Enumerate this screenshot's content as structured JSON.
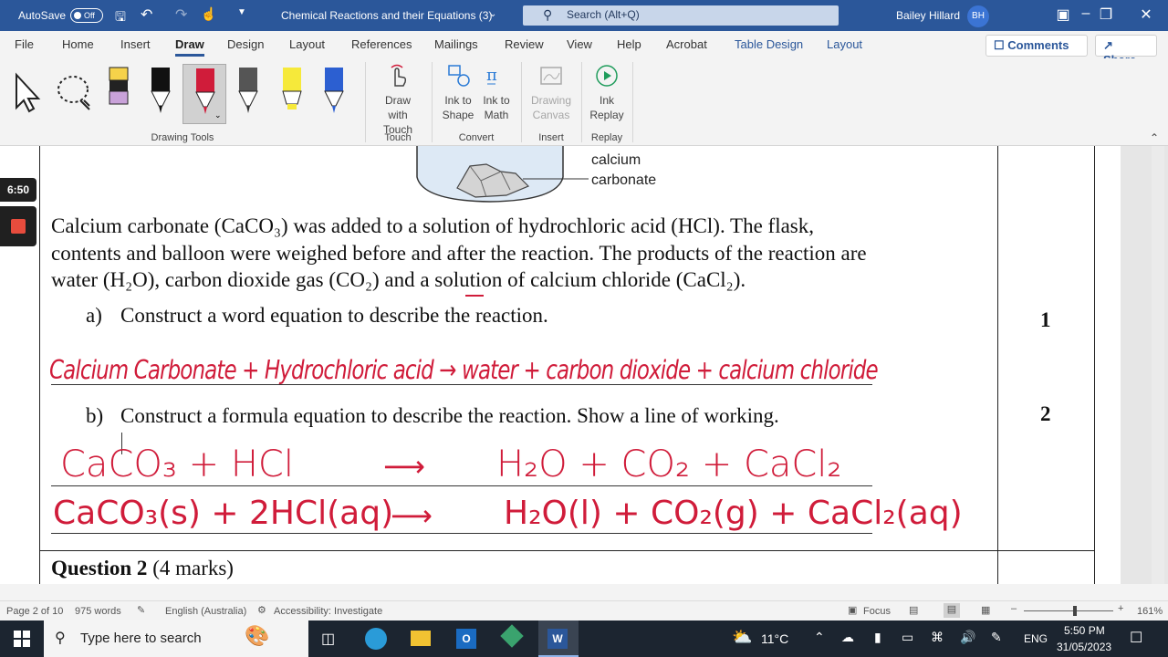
{
  "titlebar": {
    "autosave_label": "AutoSave",
    "autosave_state": "Off",
    "doc_title": "Chemical Reactions and their Equations (3)",
    "search_placeholder": "Search (Alt+Q)",
    "user_name": "Bailey Hillard",
    "user_initials": "BH"
  },
  "menu": {
    "tabs": [
      "File",
      "Home",
      "Insert",
      "Draw",
      "Design",
      "Layout",
      "References",
      "Mailings",
      "Review",
      "View",
      "Help",
      "Acrobat",
      "Table Design",
      "Layout"
    ],
    "active_tab": "Draw",
    "comments_label": "Comments",
    "share_label": "Share"
  },
  "ribbon": {
    "drawing_tools_label": "Drawing Tools",
    "draw_with_touch": "Draw with Touch",
    "touch_label": "Touch",
    "ink_to_shape": "Ink to Shape",
    "ink_to_math": "Ink to Math",
    "convert_label": "Convert",
    "drawing_canvas": "Drawing Canvas",
    "insert_label": "Insert",
    "ink_replay": "Ink Replay",
    "replay_label": "Replay"
  },
  "recorder": {
    "time": "6:50"
  },
  "document": {
    "figure_label_1": "calcium",
    "figure_label_2": "carbonate",
    "para_line1": "Calcium carbonate (CaCO₃) was added to a solution of hydrochloric acid (HCl). The flask,",
    "para_line2": "contents and balloon were weighed before and after the reaction. The products of the reaction are",
    "para_line3": "water (H₂O), carbon dioxide gas (CO₂) and a solution of calcium chloride (CaCl₂).",
    "q_a_marker": "a)",
    "q_a_text": "Construct a word equation to describe the reaction.",
    "q_a_marks": "1",
    "q_b_marker": "b)",
    "q_b_text": "Construct a formula equation to describe the reaction. Show a line of working.",
    "q_b_marks": "2",
    "question2_bold": "Question 2",
    "question2_marks": "(4 marks)",
    "ink_word_eq": "Calcium Carbonate + Hydrochloric acid → water + carbon dioxide + calcium chloride",
    "ink_formula_lhs": "CaCO₃ + HCl",
    "ink_formula_rhs": "H₂O + CO₂ + CaCl₂",
    "ink_state_lhs": "CaCO₃(s) + 2HCl(aq)",
    "ink_state_rhs": "H₂O(l) + CO₂(g) + CaCl₂(aq)"
  },
  "status": {
    "page": "Page 2 of 10",
    "words": "975 words",
    "language": "English (Australia)",
    "accessibility": "Accessibility: Investigate",
    "focus": "Focus",
    "zoom": "161%"
  },
  "taskbar": {
    "search_placeholder": "Type here to search",
    "temperature": "11°C",
    "lang": "ENG",
    "time": "5:50 PM",
    "date": "31/05/2023"
  }
}
